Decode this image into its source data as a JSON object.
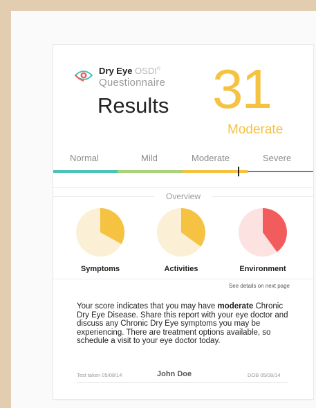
{
  "header": {
    "brand_name": "Dry Eye",
    "brand_suffix": "OSDI",
    "brand_mark": "®",
    "subtitle": "Questionnaire",
    "title": "Results"
  },
  "score": {
    "value": "31",
    "category": "Moderate",
    "color": "#f5c242"
  },
  "scale": {
    "labels": [
      "Normal",
      "Mild",
      "Moderate",
      "Severe"
    ],
    "colors": [
      "#4cc2b8",
      "#a8d37a",
      "#f5c242",
      "#6f7d9b"
    ]
  },
  "overview": {
    "label": "Overview",
    "items": [
      {
        "label": "Symptoms",
        "fraction": 0.33,
        "fill": "#f5c242",
        "bg": "#fbf0d6"
      },
      {
        "label": "Activities",
        "fraction": 0.35,
        "fill": "#f5c242",
        "bg": "#fbf0d6"
      },
      {
        "label": "Environment",
        "fraction": 0.4,
        "fill": "#f25c5c",
        "bg": "#fde2e2"
      }
    ],
    "note": "See details on next page"
  },
  "message": {
    "prefix": "Your score indicates that you may have ",
    "emphasis": "moderate",
    "suffix": " Chronic Dry Eye Disease. Share this report with your eye doctor and discuss any Chronic Dry Eye symptoms you may be experiencing. There are treatment options available, so schedule a visit to your eye doctor today."
  },
  "footer": {
    "test_taken": "Test taken 05/08/14",
    "patient_name": "John Doe",
    "dob": "DOB 05/08/14"
  }
}
